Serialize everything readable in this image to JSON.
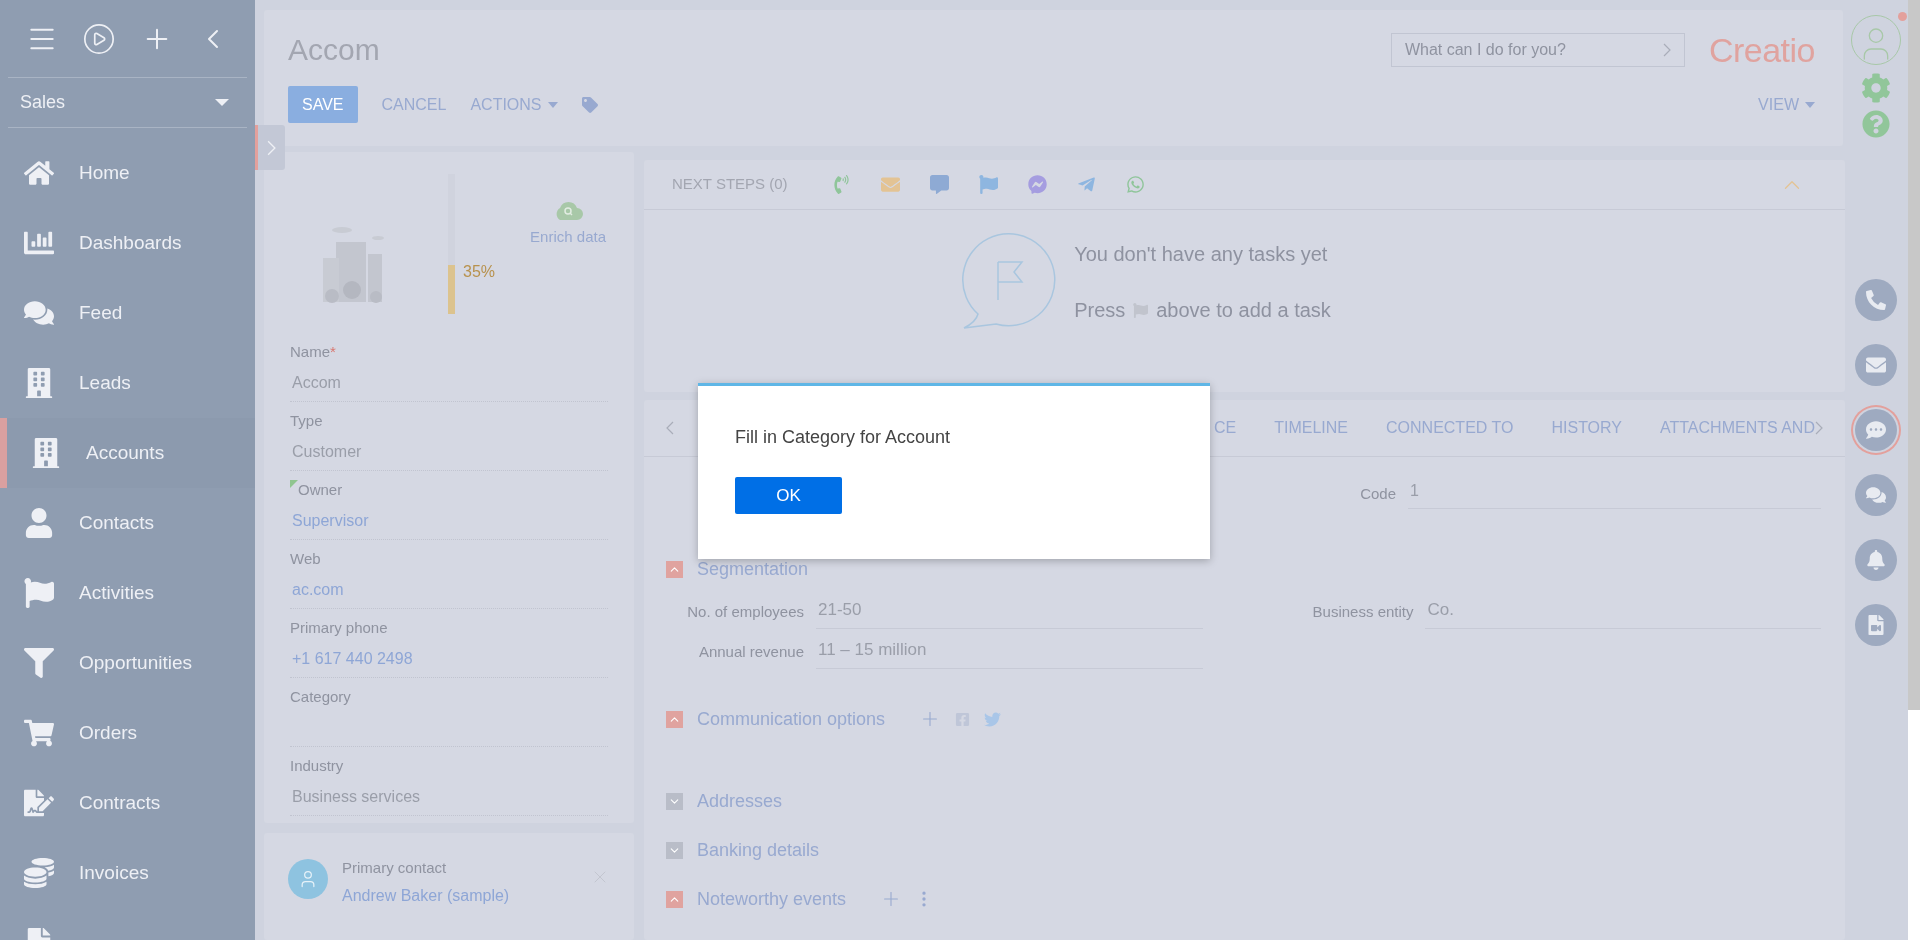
{
  "sidebar": {
    "section": "Sales",
    "items": [
      {
        "label": "Home",
        "selected": false
      },
      {
        "label": "Dashboards",
        "selected": false
      },
      {
        "label": "Feed",
        "selected": false
      },
      {
        "label": "Leads",
        "selected": false
      },
      {
        "label": "Accounts",
        "selected": true
      },
      {
        "label": "Contacts",
        "selected": false
      },
      {
        "label": "Activities",
        "selected": false
      },
      {
        "label": "Opportunities",
        "selected": false
      },
      {
        "label": "Orders",
        "selected": false
      },
      {
        "label": "Contracts",
        "selected": false
      },
      {
        "label": "Invoices",
        "selected": false
      },
      {
        "selected": false
      }
    ]
  },
  "header": {
    "title": "Accom",
    "buttons": [
      {
        "label": "SAVE",
        "kind": "primary"
      },
      {
        "label": "CANCEL",
        "kind": "link"
      },
      {
        "label": "ACTIONS",
        "kind": "menu"
      }
    ],
    "view": "VIEW",
    "search": {
      "placeholder": "What can I do for you?"
    },
    "logo": "Creatio"
  },
  "profile": {
    "has_notification": true
  },
  "account_card": {
    "completeness": {
      "level": 0.35,
      "reading": "35%"
    },
    "enrich": "Enrich data",
    "fields": [
      {
        "label": "Name",
        "required_mark": "*",
        "flagged": false,
        "kind": "text",
        "value": "Accom"
      },
      {
        "label": "Type",
        "flagged": false,
        "kind": "text",
        "value": "Customer"
      },
      {
        "label": "Owner",
        "flagged": true,
        "kind": "link",
        "value": "Supervisor"
      },
      {
        "label": "Web",
        "flagged": false,
        "kind": "link",
        "value": "ac.com"
      },
      {
        "label": "Primary phone",
        "flagged": false,
        "kind": "link",
        "value": "+1 617 440 2498"
      },
      {
        "label": "Category",
        "flagged": false,
        "kind": "text"
      },
      {
        "label": "Industry",
        "flagged": false,
        "kind": "text",
        "value": "Business services"
      }
    ]
  },
  "primary_contact": {
    "label": "Primary contact",
    "name": "Andrew Baker (sample)"
  },
  "next_steps": {
    "title": "NEXT STEPS (0)",
    "empty_title": "You don't have any tasks yet",
    "hint_before": "Press",
    "hint_after": "above to add a task"
  },
  "tabs": [
    {
      "label": "CE",
      "selected": false
    },
    {
      "label": "TIMELINE",
      "selected": false
    },
    {
      "label": "CONNECTED TO",
      "selected": false
    },
    {
      "label": "HISTORY",
      "selected": false
    },
    {
      "label": "ATTACHMENTS AND",
      "selected": false
    }
  ],
  "details": {
    "top_field": {
      "label": "Code",
      "value": "1"
    },
    "sections": [
      {
        "title": "Segmentation",
        "expanded": true,
        "kind": "fields",
        "fields": [
          {
            "label": "No. of employees",
            "value": "21-50"
          },
          {
            "label": "Business entity",
            "value": "Co."
          },
          {
            "label": "Annual revenue",
            "value": "11 – 15 million"
          }
        ]
      },
      {
        "title": "Communication options",
        "expanded": true,
        "kind": "social"
      },
      {
        "title": "Addresses",
        "expanded": false,
        "kind": "plain"
      },
      {
        "title": "Banking details",
        "expanded": false,
        "kind": "plain"
      },
      {
        "title": "Noteworthy events",
        "expanded": true,
        "kind": "menu"
      }
    ]
  },
  "dialog": {
    "message": "Fill in Category for Account",
    "button": "OK"
  },
  "right_rail": [
    {
      "selected": false
    },
    {
      "selected": false
    },
    {
      "selected": true
    },
    {
      "selected": false
    },
    {
      "selected": false
    },
    {
      "selected": false
    }
  ]
}
